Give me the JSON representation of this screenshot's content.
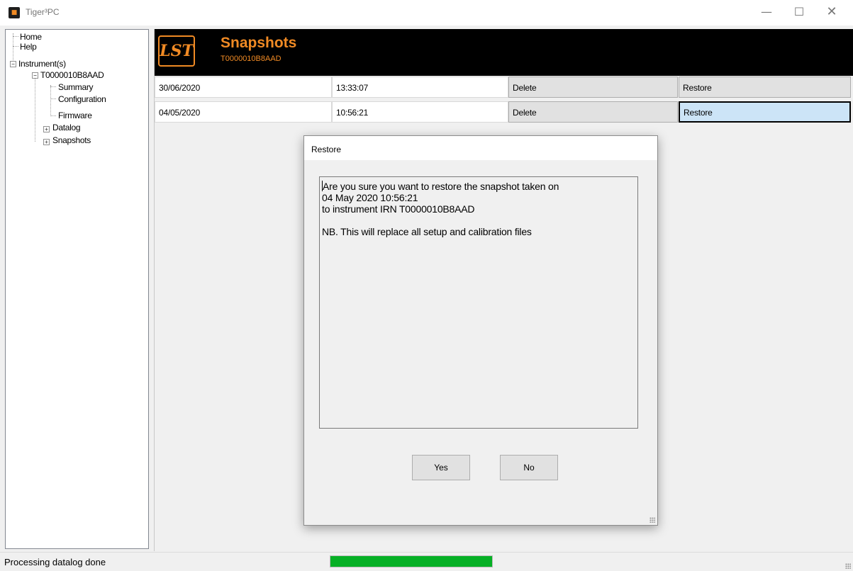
{
  "window": {
    "title": "Tiger³PC",
    "icon": "lst-logo-icon",
    "controls": {
      "minimize": "—",
      "maximize": "☐",
      "close": "✕"
    }
  },
  "tree": {
    "items": [
      {
        "label": "Home"
      },
      {
        "label": "Help"
      },
      {
        "label": "Instrument(s)",
        "expander": "−"
      },
      {
        "label": "T0000010B8AAD",
        "expander": "−"
      },
      {
        "label": "Summary"
      },
      {
        "label": "Configuration"
      },
      {
        "label": "Firmware"
      },
      {
        "label": "Datalog",
        "expander": "+"
      },
      {
        "label": "Snapshots",
        "expander": "+"
      }
    ]
  },
  "header": {
    "logo_text": "LST",
    "title": "Snapshots",
    "subtitle": "T0000010B8AAD",
    "accent_color": "#f08a24"
  },
  "snapshots": [
    {
      "date": "30/06/2020",
      "time": "13:33:07",
      "delete_label": "Delete",
      "restore_label": "Restore"
    },
    {
      "date": "04/05/2020",
      "time": "10:56:21",
      "delete_label": "Delete",
      "restore_label": "Restore",
      "selected": "restore"
    }
  ],
  "dialog": {
    "title": "Restore",
    "message_lines": [
      "Are you sure you want to restore the snapshot taken on",
      "04 May 2020 10:56:21",
      "to instrument IRN T0000010B8AAD",
      "",
      "NB. This will replace all setup and calibration files"
    ],
    "yes_label": "Yes",
    "no_label": "No"
  },
  "status": {
    "text": "Processing datalog done",
    "progress_percent": 100,
    "progress_color": "#06b025"
  }
}
